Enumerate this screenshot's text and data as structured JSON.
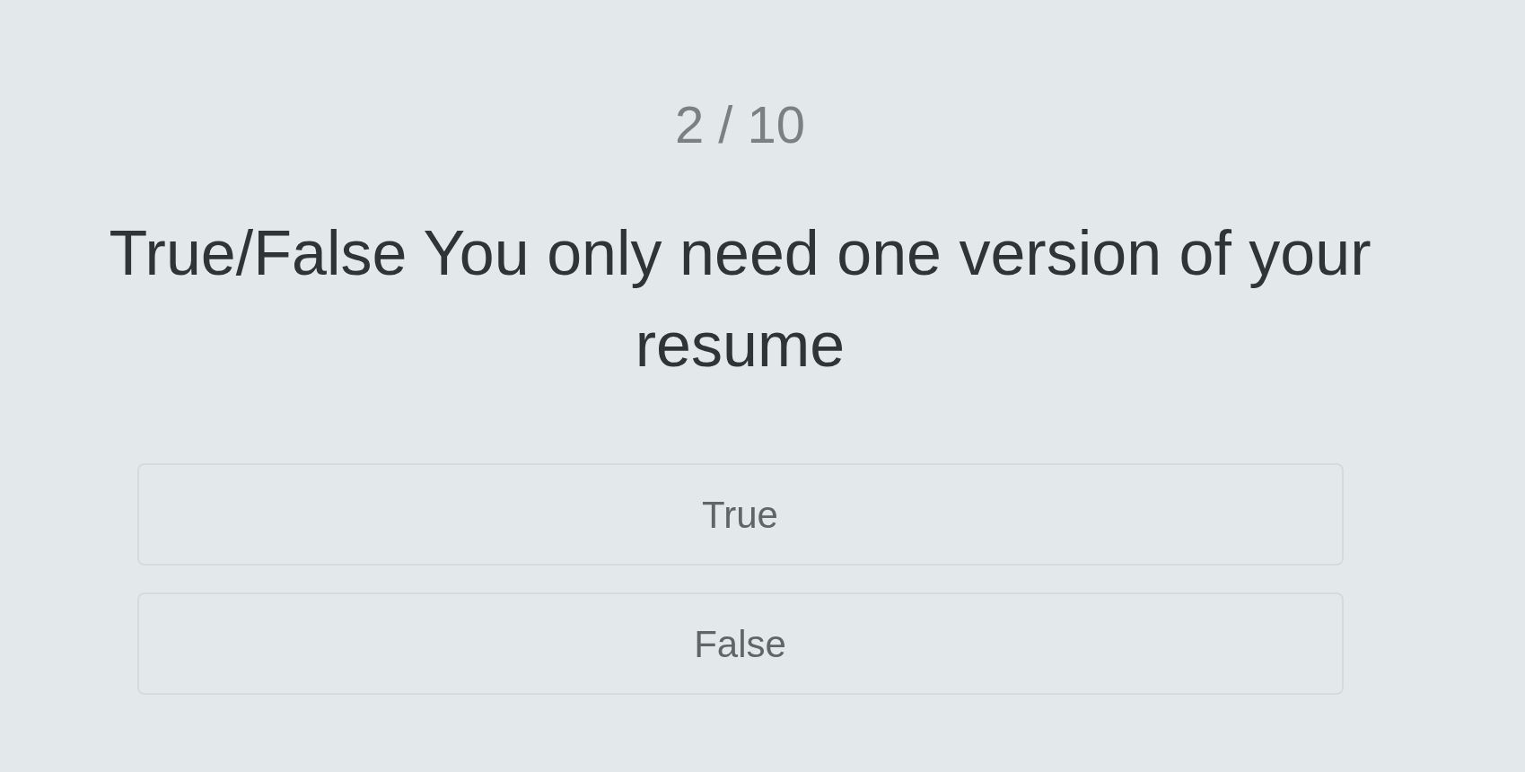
{
  "counter": "2 / 10",
  "question": "True/False You only need one version of your resume",
  "options": [
    {
      "label": "True"
    },
    {
      "label": "False"
    }
  ]
}
